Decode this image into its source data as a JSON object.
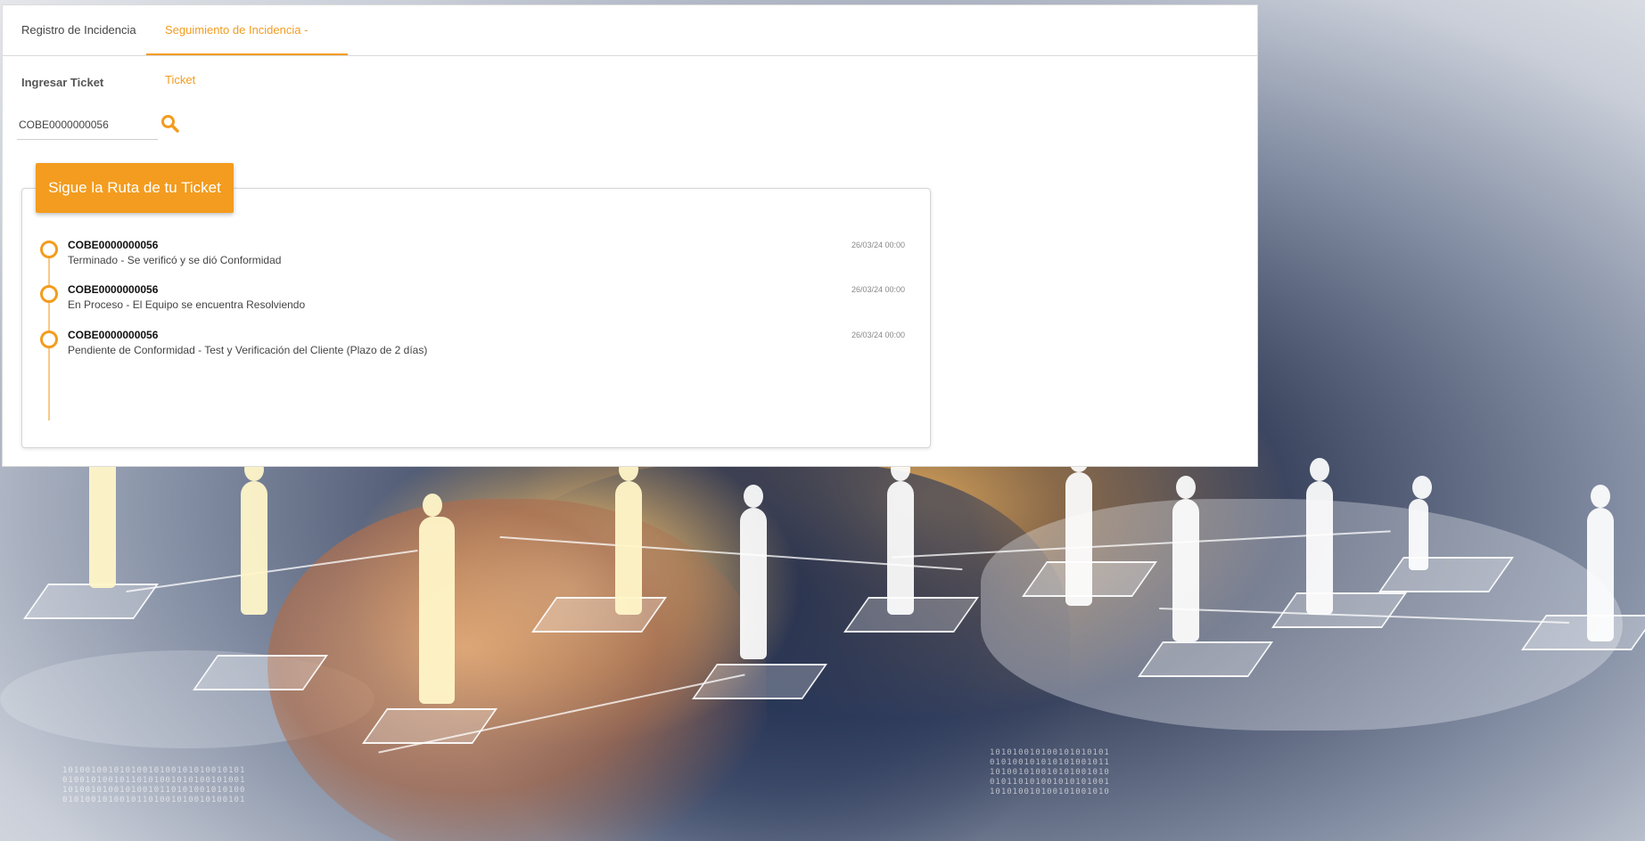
{
  "tabs": [
    {
      "label": "Registro de Incidencia",
      "active": false
    },
    {
      "label": "Seguimiento de Incidencia - Ticket",
      "active": true
    }
  ],
  "form": {
    "label": "Ingresar Ticket",
    "ticket_value": "COBE0000000056",
    "search_icon": "search-icon"
  },
  "route": {
    "header": "Sigue la Ruta de tu Ticket",
    "items": [
      {
        "ticket": "COBE0000000056",
        "status": "Terminado - Se verificó y se dió Conformidad",
        "date": "26/03/24 00:00"
      },
      {
        "ticket": "COBE0000000056",
        "status": "En Proceso - El Equipo se encuentra Resolviendo",
        "date": "26/03/24 00:00"
      },
      {
        "ticket": "COBE0000000056",
        "status": "Pendiente de Conformidad - Test y Verificación del Cliente (Plazo de 2 días)",
        "date": "26/03/24 00:00"
      }
    ]
  },
  "colors": {
    "accent": "#f39c1f",
    "timeline_line": "#f7c98a",
    "panel_bg": "#ffffff"
  }
}
